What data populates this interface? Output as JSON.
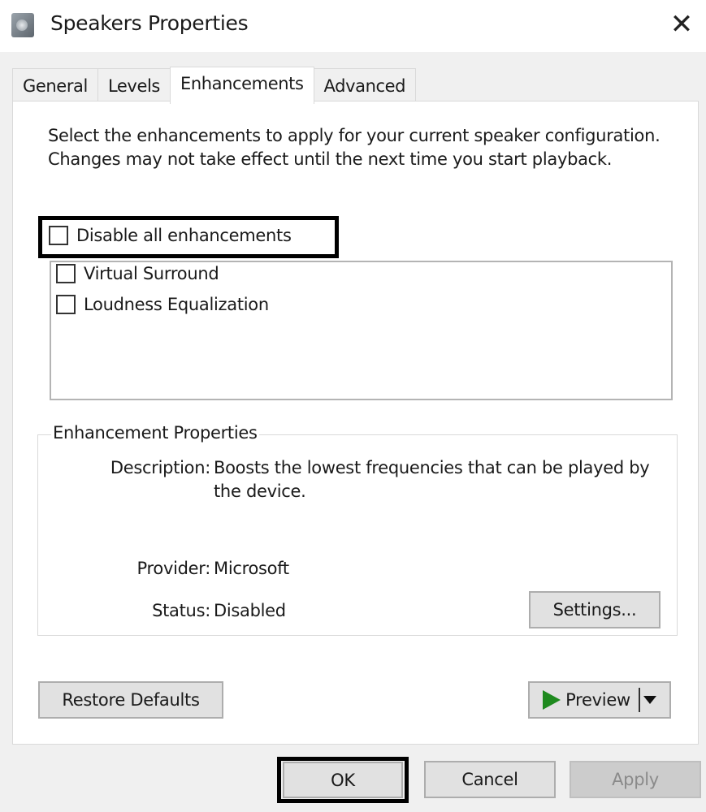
{
  "window": {
    "title": "Speakers Properties",
    "icon": "speaker-icon",
    "close_glyph": "✕"
  },
  "tabs": [
    {
      "label": "General",
      "active": false
    },
    {
      "label": "Levels",
      "active": false
    },
    {
      "label": "Enhancements",
      "active": true
    },
    {
      "label": "Advanced",
      "active": false
    }
  ],
  "enhancements": {
    "intro_text": "Select the enhancements to apply for your current speaker configuration. Changes may not take effect until the next time you start playback.",
    "disable_all": {
      "label": "Disable all enhancements",
      "checked": false
    },
    "items": [
      {
        "label": "Virtual Surround",
        "checked": false
      },
      {
        "label": "Loudness Equalization",
        "checked": false
      }
    ]
  },
  "properties": {
    "group_title": "Enhancement Properties",
    "description_label": "Description:",
    "description_value": "Boosts the lowest frequencies that can be played by the device.",
    "provider_label": "Provider:",
    "provider_value": "Microsoft",
    "status_label": "Status:",
    "status_value": "Disabled",
    "settings_button": "Settings..."
  },
  "panel_buttons": {
    "restore_defaults": "Restore Defaults",
    "preview": "Preview"
  },
  "dialog_buttons": {
    "ok": "OK",
    "cancel": "Cancel",
    "apply": "Apply",
    "apply_enabled": false
  },
  "colors": {
    "play_icon": "#1e8a1e",
    "highlight_frame": "#000000"
  }
}
